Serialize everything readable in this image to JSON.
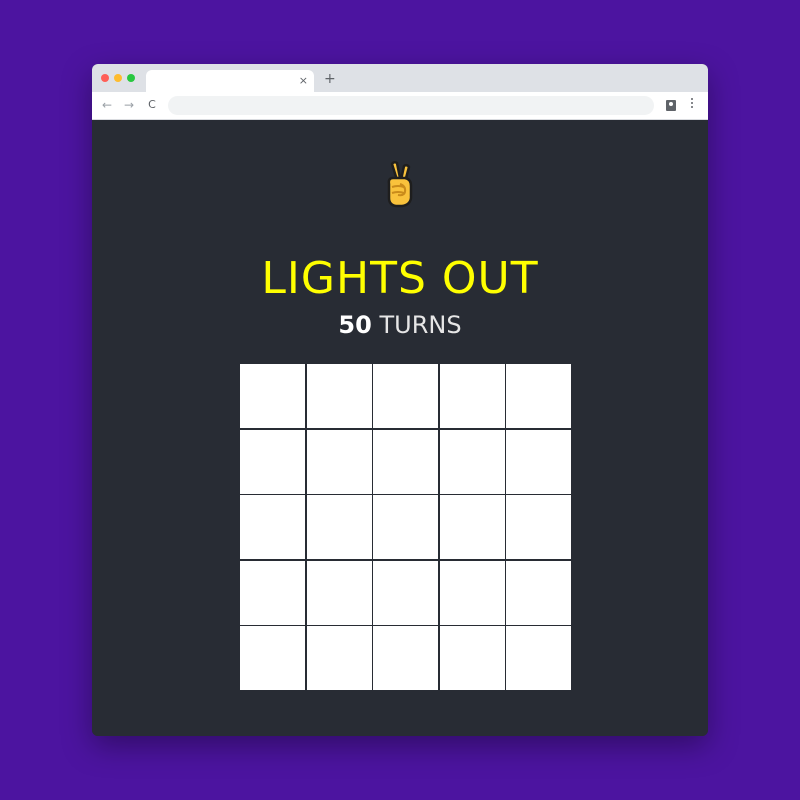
{
  "browser": {
    "tab_close": "×",
    "new_tab": "+",
    "nav": {
      "back": "←",
      "forward": "→",
      "reload": "C"
    },
    "traffic_colors": {
      "close": "#ff5f57",
      "minimize": "#febc2e",
      "zoom": "#28c840"
    },
    "address_value": ""
  },
  "game": {
    "emoji_icon": "victory-hand-icon",
    "title": "LIGHTS OUT",
    "turns_count": "50",
    "turns_label": "TURNS",
    "colors": {
      "title": "#ffff00",
      "background": "#282c34",
      "cell_on": "#ffffff"
    },
    "grid": {
      "rows": 5,
      "cols": 5,
      "cells": [
        [
          1,
          1,
          1,
          1,
          1
        ],
        [
          1,
          1,
          1,
          1,
          1
        ],
        [
          1,
          1,
          1,
          1,
          1
        ],
        [
          1,
          1,
          1,
          1,
          1
        ],
        [
          1,
          1,
          1,
          1,
          1
        ]
      ]
    }
  }
}
